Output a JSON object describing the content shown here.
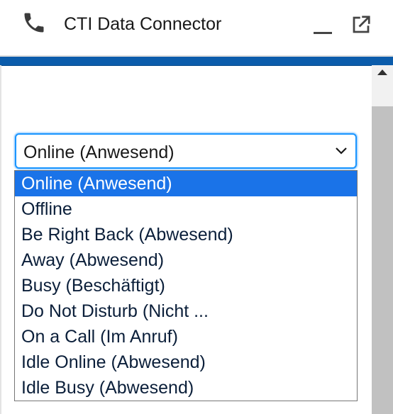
{
  "header": {
    "title": "CTI Data Connector",
    "icons": {
      "phone": "phone-icon",
      "minimize": "minimize-icon",
      "popout": "popout-icon"
    }
  },
  "status_select": {
    "value": "Online (Anwesend)",
    "options": [
      "Online (Anwesend)",
      "Offline",
      "Be Right Back (Abwesend)",
      "Away (Abwesend)",
      "Busy (Beschäftigt)",
      "Do Not Disturb (Nicht ...",
      "On a Call (Im Anruf)",
      "Idle Online (Abwesend)",
      "Idle Busy (Abwesend)"
    ],
    "highlighted_index": 0
  },
  "colors": {
    "accent_band": "#0b5cab",
    "focus_border": "#1b96ff",
    "option_highlight": "#1a73e8"
  }
}
